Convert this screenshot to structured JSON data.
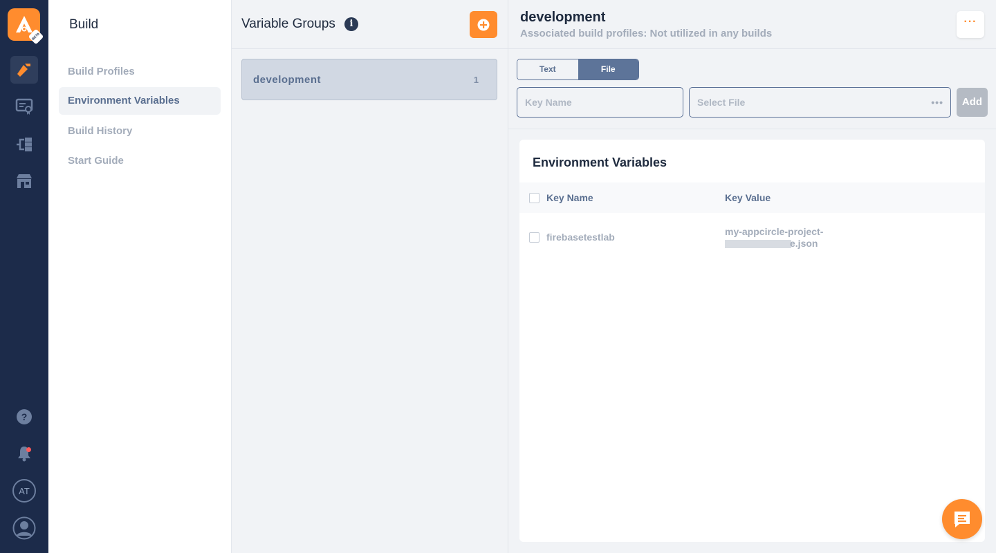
{
  "rail": {
    "logo_badge": "BETA",
    "user_initials": "AT",
    "icons": [
      "build-hammer-icon",
      "signing-identities-icon",
      "distribution-icon",
      "store-icon",
      "help-icon",
      "notification-bell-icon",
      "user-profile-icon"
    ]
  },
  "submenu": {
    "title": "Build",
    "items": [
      {
        "label": "Build Profiles"
      },
      {
        "label": "Environment Variables"
      },
      {
        "label": "Build History"
      },
      {
        "label": "Start Guide"
      }
    ]
  },
  "groups": {
    "title": "Variable Groups",
    "info_glyph": "i",
    "items": [
      {
        "name": "development",
        "count": "1"
      }
    ]
  },
  "detail": {
    "title": "development",
    "subtitle": "Associated build profiles: Not utilized in any builds",
    "more_label": "···",
    "segment": {
      "options": [
        "Text",
        "File"
      ],
      "selected": "File"
    },
    "key_input": {
      "placeholder": "Key Name"
    },
    "file_input": {
      "placeholder": "Select File"
    },
    "add_label": "Add",
    "table": {
      "title": "Environment Variables",
      "headers": [
        "Key Name",
        "Key Value"
      ],
      "rows": [
        {
          "key": "firebasetestlab",
          "value_line1": "my-appcircle-project-",
          "value_line2": "e.json"
        }
      ]
    }
  },
  "colors": {
    "rail_bg": "#1c2b4a",
    "accent": "#ff8c2e",
    "selected_segment": "#5d7499"
  }
}
